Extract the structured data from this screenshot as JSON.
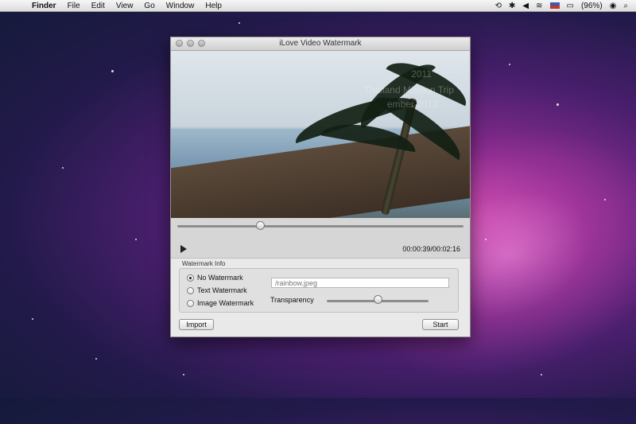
{
  "menubar": {
    "app_name": "Finder",
    "items": [
      "File",
      "Edit",
      "View",
      "Go",
      "Window",
      "Help"
    ],
    "battery": "(96%)"
  },
  "window": {
    "title": "iLove Video Watermark"
  },
  "video": {
    "overlay_line1": "2011",
    "overlay_line2": "Thailand Mission Trip",
    "overlay_line3": "ember 2012"
  },
  "player": {
    "time": "00:00:39/00:02:16",
    "seek_fraction": 0.29
  },
  "watermark": {
    "group_label": "Watermark Info",
    "options": [
      "No Watermark",
      "Text Watermark",
      "Image Watermark"
    ],
    "selected": "No Watermark",
    "image_path_placeholder": "/rainbow.jpeg",
    "transparency_label": "Transparency",
    "transparency_fraction": 0.5
  },
  "buttons": {
    "import": "Import",
    "start": "Start"
  },
  "colors": {
    "window_bg": "#e9e9e9",
    "desktop_accent": "#d04fb0"
  }
}
